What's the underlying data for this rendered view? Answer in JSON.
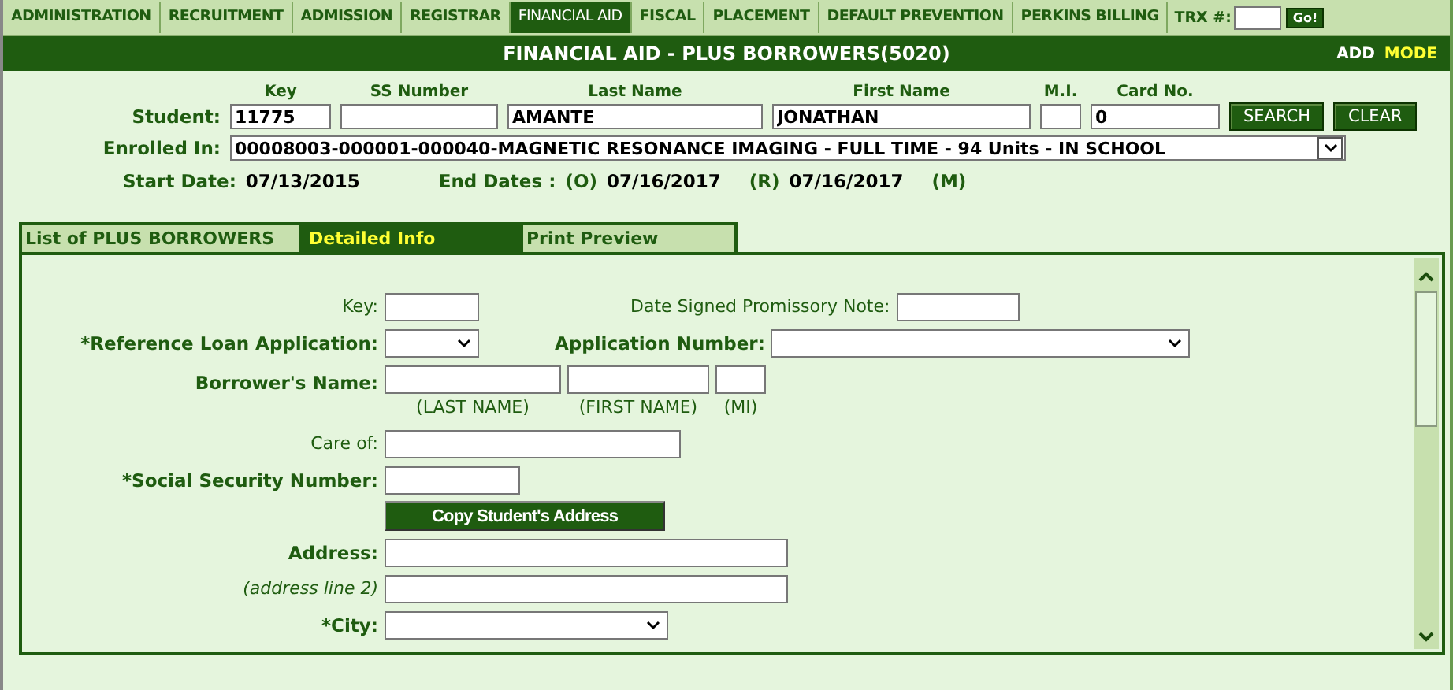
{
  "nav": [
    {
      "label": "ADMINISTRATION",
      "selected": false
    },
    {
      "label": "RECRUITMENT",
      "selected": false
    },
    {
      "label": "ADMISSION",
      "selected": false
    },
    {
      "label": "REGISTRAR",
      "selected": false
    },
    {
      "label": "FINANCIAL AID",
      "selected": true
    },
    {
      "label": "FISCAL",
      "selected": false
    },
    {
      "label": "PLACEMENT",
      "selected": false
    },
    {
      "label": "DEFAULT PREVENTION",
      "selected": false
    },
    {
      "label": "PERKINS BILLING",
      "selected": false
    }
  ],
  "trx": {
    "label": "TRX #:",
    "button": "Go!"
  },
  "title_bar": {
    "title": "FINANCIAL AID - PLUS BORROWERS(5020)",
    "action": "ADD",
    "mode": "MODE"
  },
  "student": {
    "label": "Student:",
    "fields": [
      {
        "heading": "Key",
        "value": "11775"
      },
      {
        "heading": "SS Number"
      },
      {
        "heading": "Last Name",
        "value": "AMANTE"
      },
      {
        "heading": "First Name",
        "value": "JONATHAN"
      },
      {
        "heading": "M.I."
      },
      {
        "heading": "Card No.",
        "value": "0"
      }
    ],
    "buttons": [
      "SEARCH",
      "CLEAR"
    ]
  },
  "enrolled": {
    "label": "Enrolled In:",
    "value": "00008003-000001-000040-MAGNETIC RESONANCE IMAGING - FULL TIME - 94 Units - IN SCHOOL"
  },
  "dates": {
    "start_label": "Start Date:",
    "start": "07/13/2015",
    "end_label": "End Dates :",
    "o_label": "(O)",
    "o": "07/16/2017",
    "r_label": "(R)",
    "r": "07/16/2017",
    "m_label": "(M)"
  },
  "tabs": [
    {
      "label": "List of PLUS BORROWERS",
      "selected": false
    },
    {
      "label": "Detailed Info",
      "selected": true
    },
    {
      "label": "Print Preview",
      "selected": false
    }
  ],
  "form": [
    {
      "kind": "text",
      "label": "Key:",
      "extra": {
        "kind": "text",
        "label": "Date Signed Promissory Note:"
      }
    },
    {
      "kind": "select",
      "label": "*Reference Loan Application:",
      "extra": {
        "kind": "select",
        "label": "Application Number:"
      }
    },
    {
      "kind": "name",
      "label": "Borrower's Name:",
      "parts": [
        "(LAST NAME)",
        "(FIRST NAME)",
        "(MI)"
      ]
    },
    {
      "kind": "text",
      "label": "Care of:"
    },
    {
      "kind": "text",
      "label": "*Social Security Number:"
    },
    {
      "kind": "button",
      "label": "Copy Student's Address"
    },
    {
      "kind": "text",
      "label": "Address:"
    },
    {
      "kind": "text",
      "label": "(address line 2)"
    },
    {
      "kind": "select",
      "label": "*City:"
    }
  ]
}
